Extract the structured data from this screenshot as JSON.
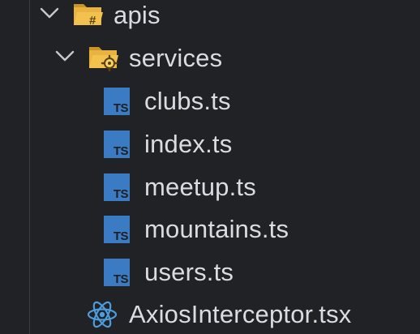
{
  "explorer": {
    "folder_apis": {
      "label": "apis",
      "icon": "folder-open-api-icon",
      "expanded": true
    },
    "folder_services": {
      "label": "services",
      "icon": "folder-open-gear-icon",
      "expanded": true
    },
    "ts_badge": "TS",
    "files": [
      {
        "label": "clubs.ts",
        "icon": "typescript-icon"
      },
      {
        "label": "index.ts",
        "icon": "typescript-icon"
      },
      {
        "label": "meetup.ts",
        "icon": "typescript-icon"
      },
      {
        "label": "mountains.ts",
        "icon": "typescript-icon"
      },
      {
        "label": "users.ts",
        "icon": "typescript-icon"
      }
    ],
    "component_file": {
      "label": "AxiosInterceptor.tsx",
      "icon": "react-icon"
    }
  },
  "colors": {
    "background": "#202226",
    "text": "#d9dce2",
    "folder": "#e8b33e",
    "typescript": "#3b7bc4",
    "react": "#4d9cdc"
  }
}
